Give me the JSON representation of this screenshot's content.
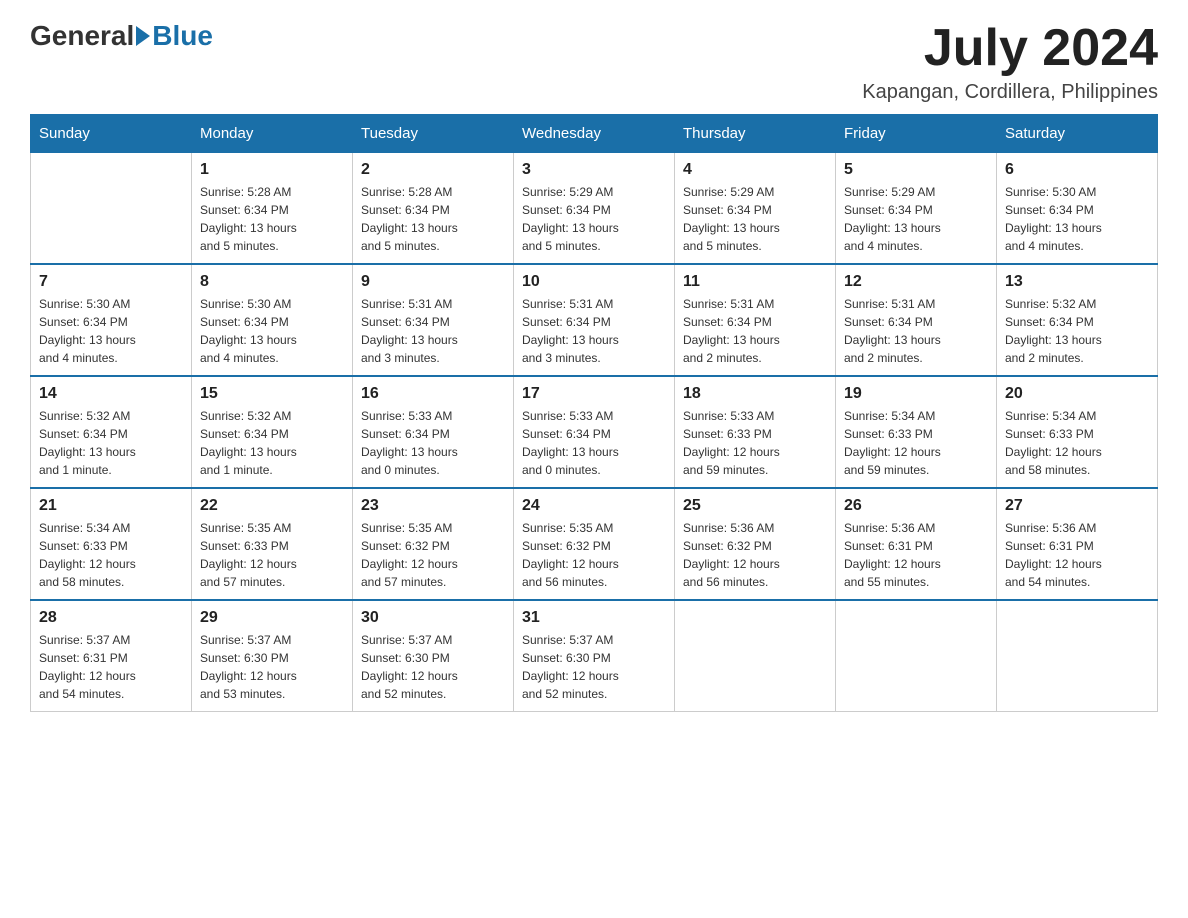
{
  "header": {
    "logo_general": "General",
    "logo_blue": "Blue",
    "month_year": "July 2024",
    "location": "Kapangan, Cordillera, Philippines"
  },
  "columns": [
    "Sunday",
    "Monday",
    "Tuesday",
    "Wednesday",
    "Thursday",
    "Friday",
    "Saturday"
  ],
  "weeks": [
    [
      {
        "day": "",
        "info": ""
      },
      {
        "day": "1",
        "info": "Sunrise: 5:28 AM\nSunset: 6:34 PM\nDaylight: 13 hours\nand 5 minutes."
      },
      {
        "day": "2",
        "info": "Sunrise: 5:28 AM\nSunset: 6:34 PM\nDaylight: 13 hours\nand 5 minutes."
      },
      {
        "day": "3",
        "info": "Sunrise: 5:29 AM\nSunset: 6:34 PM\nDaylight: 13 hours\nand 5 minutes."
      },
      {
        "day": "4",
        "info": "Sunrise: 5:29 AM\nSunset: 6:34 PM\nDaylight: 13 hours\nand 5 minutes."
      },
      {
        "day": "5",
        "info": "Sunrise: 5:29 AM\nSunset: 6:34 PM\nDaylight: 13 hours\nand 4 minutes."
      },
      {
        "day": "6",
        "info": "Sunrise: 5:30 AM\nSunset: 6:34 PM\nDaylight: 13 hours\nand 4 minutes."
      }
    ],
    [
      {
        "day": "7",
        "info": "Sunrise: 5:30 AM\nSunset: 6:34 PM\nDaylight: 13 hours\nand 4 minutes."
      },
      {
        "day": "8",
        "info": "Sunrise: 5:30 AM\nSunset: 6:34 PM\nDaylight: 13 hours\nand 4 minutes."
      },
      {
        "day": "9",
        "info": "Sunrise: 5:31 AM\nSunset: 6:34 PM\nDaylight: 13 hours\nand 3 minutes."
      },
      {
        "day": "10",
        "info": "Sunrise: 5:31 AM\nSunset: 6:34 PM\nDaylight: 13 hours\nand 3 minutes."
      },
      {
        "day": "11",
        "info": "Sunrise: 5:31 AM\nSunset: 6:34 PM\nDaylight: 13 hours\nand 2 minutes."
      },
      {
        "day": "12",
        "info": "Sunrise: 5:31 AM\nSunset: 6:34 PM\nDaylight: 13 hours\nand 2 minutes."
      },
      {
        "day": "13",
        "info": "Sunrise: 5:32 AM\nSunset: 6:34 PM\nDaylight: 13 hours\nand 2 minutes."
      }
    ],
    [
      {
        "day": "14",
        "info": "Sunrise: 5:32 AM\nSunset: 6:34 PM\nDaylight: 13 hours\nand 1 minute."
      },
      {
        "day": "15",
        "info": "Sunrise: 5:32 AM\nSunset: 6:34 PM\nDaylight: 13 hours\nand 1 minute."
      },
      {
        "day": "16",
        "info": "Sunrise: 5:33 AM\nSunset: 6:34 PM\nDaylight: 13 hours\nand 0 minutes."
      },
      {
        "day": "17",
        "info": "Sunrise: 5:33 AM\nSunset: 6:34 PM\nDaylight: 13 hours\nand 0 minutes."
      },
      {
        "day": "18",
        "info": "Sunrise: 5:33 AM\nSunset: 6:33 PM\nDaylight: 12 hours\nand 59 minutes."
      },
      {
        "day": "19",
        "info": "Sunrise: 5:34 AM\nSunset: 6:33 PM\nDaylight: 12 hours\nand 59 minutes."
      },
      {
        "day": "20",
        "info": "Sunrise: 5:34 AM\nSunset: 6:33 PM\nDaylight: 12 hours\nand 58 minutes."
      }
    ],
    [
      {
        "day": "21",
        "info": "Sunrise: 5:34 AM\nSunset: 6:33 PM\nDaylight: 12 hours\nand 58 minutes."
      },
      {
        "day": "22",
        "info": "Sunrise: 5:35 AM\nSunset: 6:33 PM\nDaylight: 12 hours\nand 57 minutes."
      },
      {
        "day": "23",
        "info": "Sunrise: 5:35 AM\nSunset: 6:32 PM\nDaylight: 12 hours\nand 57 minutes."
      },
      {
        "day": "24",
        "info": "Sunrise: 5:35 AM\nSunset: 6:32 PM\nDaylight: 12 hours\nand 56 minutes."
      },
      {
        "day": "25",
        "info": "Sunrise: 5:36 AM\nSunset: 6:32 PM\nDaylight: 12 hours\nand 56 minutes."
      },
      {
        "day": "26",
        "info": "Sunrise: 5:36 AM\nSunset: 6:31 PM\nDaylight: 12 hours\nand 55 minutes."
      },
      {
        "day": "27",
        "info": "Sunrise: 5:36 AM\nSunset: 6:31 PM\nDaylight: 12 hours\nand 54 minutes."
      }
    ],
    [
      {
        "day": "28",
        "info": "Sunrise: 5:37 AM\nSunset: 6:31 PM\nDaylight: 12 hours\nand 54 minutes."
      },
      {
        "day": "29",
        "info": "Sunrise: 5:37 AM\nSunset: 6:30 PM\nDaylight: 12 hours\nand 53 minutes."
      },
      {
        "day": "30",
        "info": "Sunrise: 5:37 AM\nSunset: 6:30 PM\nDaylight: 12 hours\nand 52 minutes."
      },
      {
        "day": "31",
        "info": "Sunrise: 5:37 AM\nSunset: 6:30 PM\nDaylight: 12 hours\nand 52 minutes."
      },
      {
        "day": "",
        "info": ""
      },
      {
        "day": "",
        "info": ""
      },
      {
        "day": "",
        "info": ""
      }
    ]
  ]
}
